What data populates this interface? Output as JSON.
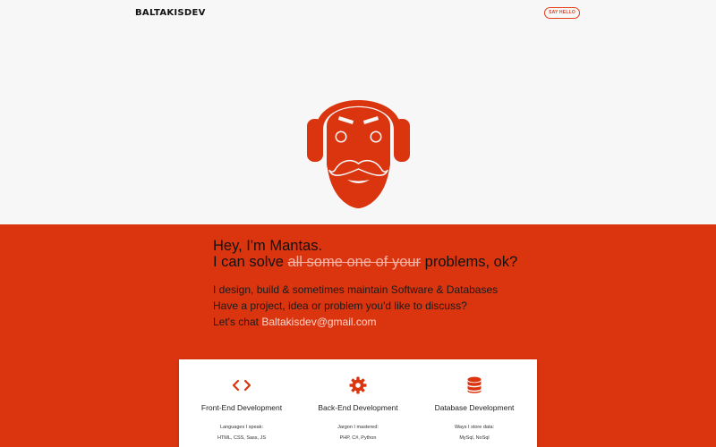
{
  "nav": {
    "logo": "BALTAKISDEV",
    "cta": "SAY HELLO"
  },
  "colors": {
    "accent": "#db3510",
    "card": "#ffffff",
    "background": "#f7f7f7"
  },
  "hero": {
    "greeting": "Hey, I'm Mantas.",
    "line2_prefix": "I can solve ",
    "line2_strike": "all some one of your",
    "line2_suffix": " problems, ok?",
    "intro1": "I design, build & sometimes maintain Software & Databases",
    "intro2": "Have a project, idea or problem you'd like to discuss?",
    "chat_prefix": "Let's chat ",
    "email": "Baltakisdev@gmail.com"
  },
  "services": [
    {
      "icon": "code-icon",
      "title": "Front-End Development",
      "subtitle": "Languages I speak:",
      "value": "HTML, CSS, Sass, JS"
    },
    {
      "icon": "gear-icon",
      "title": "Back-End Development",
      "subtitle": "Jargon I mastered:",
      "value": "PHP, C#, Python"
    },
    {
      "icon": "database-icon",
      "title": "Database Development",
      "subtitle": "Ways I store data:",
      "value": "MySql, NoSql"
    }
  ]
}
